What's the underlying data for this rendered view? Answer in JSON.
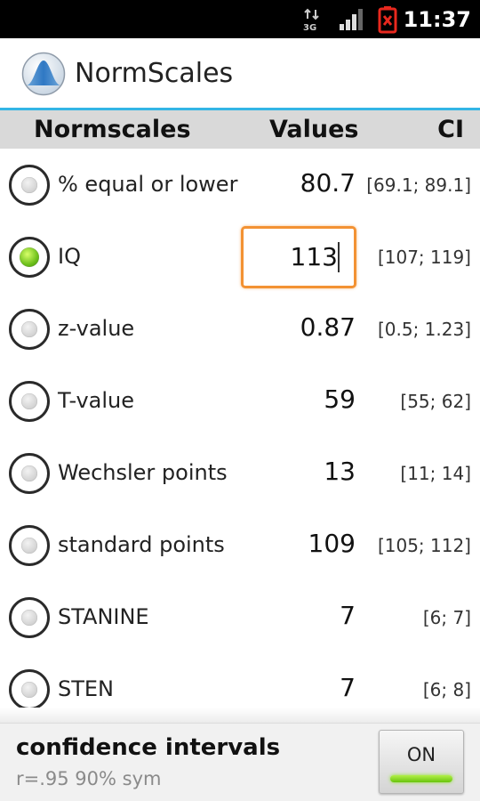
{
  "status_bar": {
    "network_icon": "3g-data-icon",
    "signal_icon": "signal-bars-icon",
    "battery_icon": "battery-empty-icon",
    "time": "11:37"
  },
  "app": {
    "title": "NormScales",
    "icon": "normal-distribution-icon"
  },
  "columns": {
    "normscales": "Normscales",
    "values": "Values",
    "ci": "CI"
  },
  "rows": [
    {
      "label": "% equal or lower",
      "value": "80.7",
      "ci": "[69.1; 89.1]",
      "selected": false
    },
    {
      "label": "IQ",
      "value": "113",
      "ci": "[107; 119]",
      "selected": true
    },
    {
      "label": "z-value",
      "value": "0.87",
      "ci": "[0.5; 1.23]",
      "selected": false
    },
    {
      "label": "T-value",
      "value": "59",
      "ci": "[55; 62]",
      "selected": false
    },
    {
      "label": "Wechsler points",
      "value": "13",
      "ci": "[11; 14]",
      "selected": false
    },
    {
      "label": "standard points",
      "value": "109",
      "ci": "[105; 112]",
      "selected": false
    },
    {
      "label": "STANINE",
      "value": "7",
      "ci": "[6; 7]",
      "selected": false
    },
    {
      "label": "STEN",
      "value": "7",
      "ci": "[6; 8]",
      "selected": false
    }
  ],
  "footer": {
    "title": "confidence intervals",
    "subtitle": "r=.95 90% sym",
    "toggle_label": "ON",
    "toggle_state": true
  },
  "colors": {
    "accent_line": "#33b5e5",
    "input_focus": "#f39233",
    "radio_checked": "#6cbf1a",
    "toggle_on": "#8ee42a"
  }
}
